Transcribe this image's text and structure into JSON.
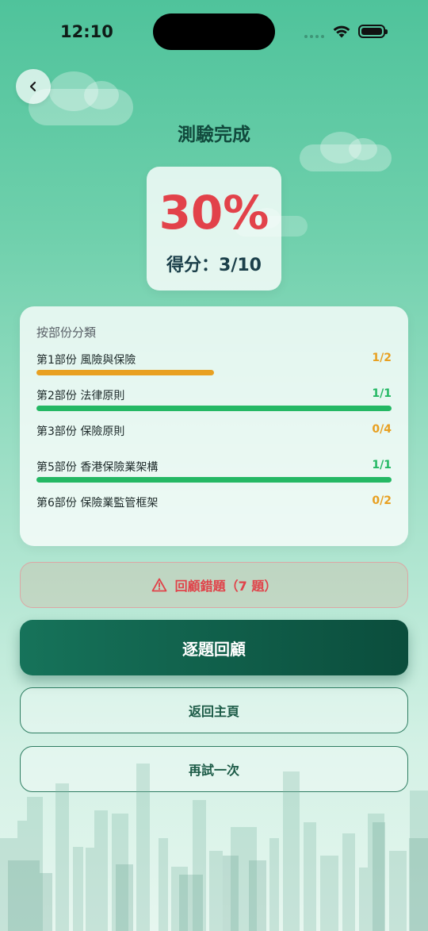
{
  "status_bar": {
    "time": "12:10"
  },
  "title": "測驗完成",
  "score": {
    "percent": "30%",
    "label": "得分：3/10",
    "correct": 3,
    "total": 10
  },
  "categories": {
    "heading": "按部份分類",
    "items": [
      {
        "label": "第1部份 風險與保險",
        "score": "1/2",
        "correct": 1,
        "total": 2,
        "color": "#e8a021"
      },
      {
        "label": "第2部份 法律原則",
        "score": "1/1",
        "correct": 1,
        "total": 1,
        "color": "#24b864"
      },
      {
        "label": "第3部份 保險原則",
        "score": "0/4",
        "correct": 0,
        "total": 4,
        "color": "#e8a021"
      },
      {
        "label": "第5部份 香港保險業架構",
        "score": "1/1",
        "correct": 1,
        "total": 1,
        "color": "#24b864"
      },
      {
        "label": "第6部份 保險業監管框架",
        "score": "0/2",
        "correct": 0,
        "total": 2,
        "color": "#e8a021"
      }
    ]
  },
  "buttons": {
    "review_wrong": "回顧錯題（7 題）",
    "review_all": "逐題回顧",
    "back_home": "返回主頁",
    "retry": "再試一次"
  },
  "icons": {
    "back": "chevron-left-icon",
    "warning": "warning-triangle-icon"
  },
  "colors": {
    "accent": "#0b4d3c",
    "danger": "#e2424a",
    "partial": "#e8a021",
    "complete": "#24b864"
  }
}
